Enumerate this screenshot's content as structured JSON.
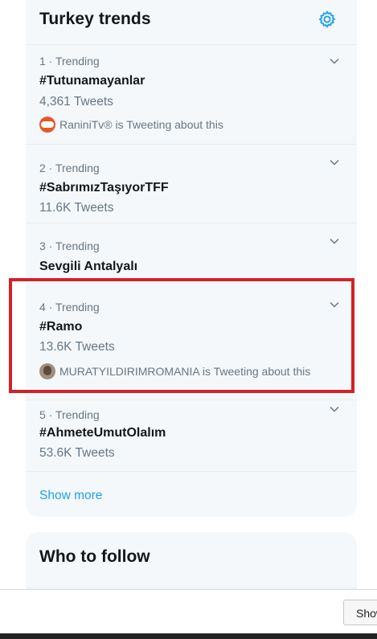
{
  "trends": {
    "title": "Turkey trends",
    "items": [
      {
        "meta": "1 · Trending",
        "name": "#Tutunamayanlar",
        "count": "4,361 Tweets",
        "context": "RaniniTv® is Tweeting about this"
      },
      {
        "meta": "2 · Trending",
        "name": "#SabrımızTaşıyorTFF",
        "count": "11.6K Tweets"
      },
      {
        "meta": "3 · Trending",
        "name": "Sevgili Antalyalı"
      },
      {
        "meta": "4 · Trending",
        "name": "#Ramo",
        "count": "13.6K Tweets",
        "context": "MURATYILDIRIMROMANIA is Tweeting about this"
      },
      {
        "meta": "5 · Trending",
        "name": "#AhmeteUmutOlalım",
        "count": "53.6K Tweets"
      }
    ],
    "show_more": "Show more"
  },
  "who_to_follow": {
    "title": "Who to follow"
  },
  "bottom_bar": {
    "button_label": "Show"
  },
  "colors": {
    "accent": "#1da1f2",
    "highlight": "#d12229",
    "card_bg": "#f5f8fa",
    "secondary_text": "#657786"
  },
  "icons": {
    "settings": "gear-icon",
    "item_menu": "chevron-down-icon"
  }
}
